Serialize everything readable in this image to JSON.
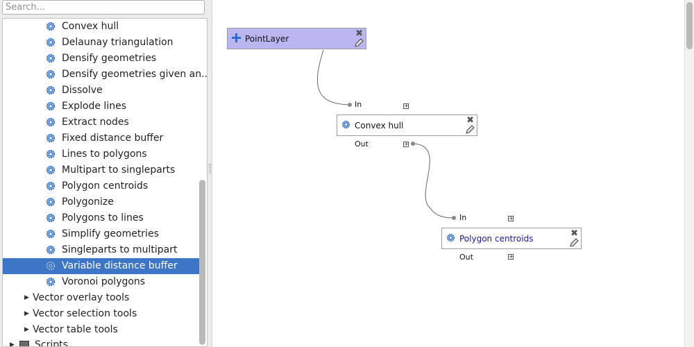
{
  "search": {
    "placeholder": "Search..."
  },
  "tree": {
    "algorithms": [
      {
        "label": "Convex hull"
      },
      {
        "label": "Delaunay triangulation"
      },
      {
        "label": "Densify geometries"
      },
      {
        "label": "Densify geometries given an..."
      },
      {
        "label": "Dissolve"
      },
      {
        "label": "Explode lines"
      },
      {
        "label": "Extract nodes"
      },
      {
        "label": "Fixed distance buffer"
      },
      {
        "label": "Lines to polygons"
      },
      {
        "label": "Multipart to singleparts"
      },
      {
        "label": "Polygon centroids"
      },
      {
        "label": "Polygonize"
      },
      {
        "label": "Polygons to lines"
      },
      {
        "label": "Simplify geometries"
      },
      {
        "label": "Singleparts to multipart"
      },
      {
        "label": "Variable distance buffer",
        "selected": true
      },
      {
        "label": "Voronoi polygons"
      }
    ],
    "groups": [
      {
        "label": "Vector overlay tools"
      },
      {
        "label": "Vector selection tools"
      },
      {
        "label": "Vector table tools"
      }
    ],
    "scripts_label": "Scripts"
  },
  "model": {
    "nodes": {
      "point_layer": {
        "title": "PointLayer",
        "icon": "plus-icon"
      },
      "convex_hull": {
        "title": "Convex hull",
        "icon": "gear-icon",
        "in_label": "In",
        "out_label": "Out"
      },
      "polygon_centroids": {
        "title": "Polygon centroids",
        "icon": "gear-icon",
        "in_label": "In",
        "out_label": "Out"
      }
    },
    "colors": {
      "input_node_fill": "#b9b6f2",
      "selected_row": "#3d76c6",
      "link_text": "#1a1a9c"
    }
  }
}
